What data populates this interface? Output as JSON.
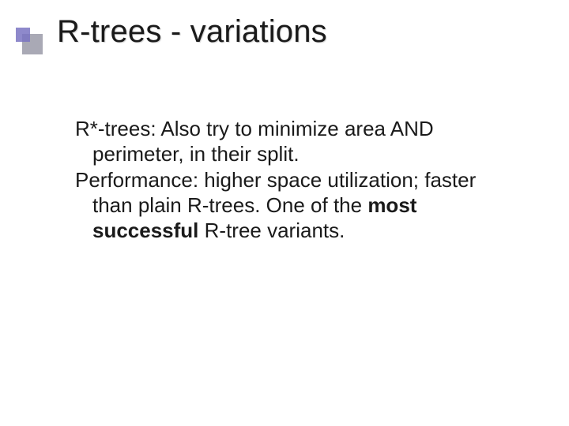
{
  "title": "R-trees - variations",
  "body": {
    "p1": {
      "lead": "R*-trees:",
      "rest": " Also try to minimize area AND perimeter, in their split."
    },
    "p2": {
      "lead": "Performance:",
      "mid": " higher space utilization; faster than plain R-trees. One of the ",
      "bold": "most successful",
      "tail": " R-tree variants."
    }
  }
}
